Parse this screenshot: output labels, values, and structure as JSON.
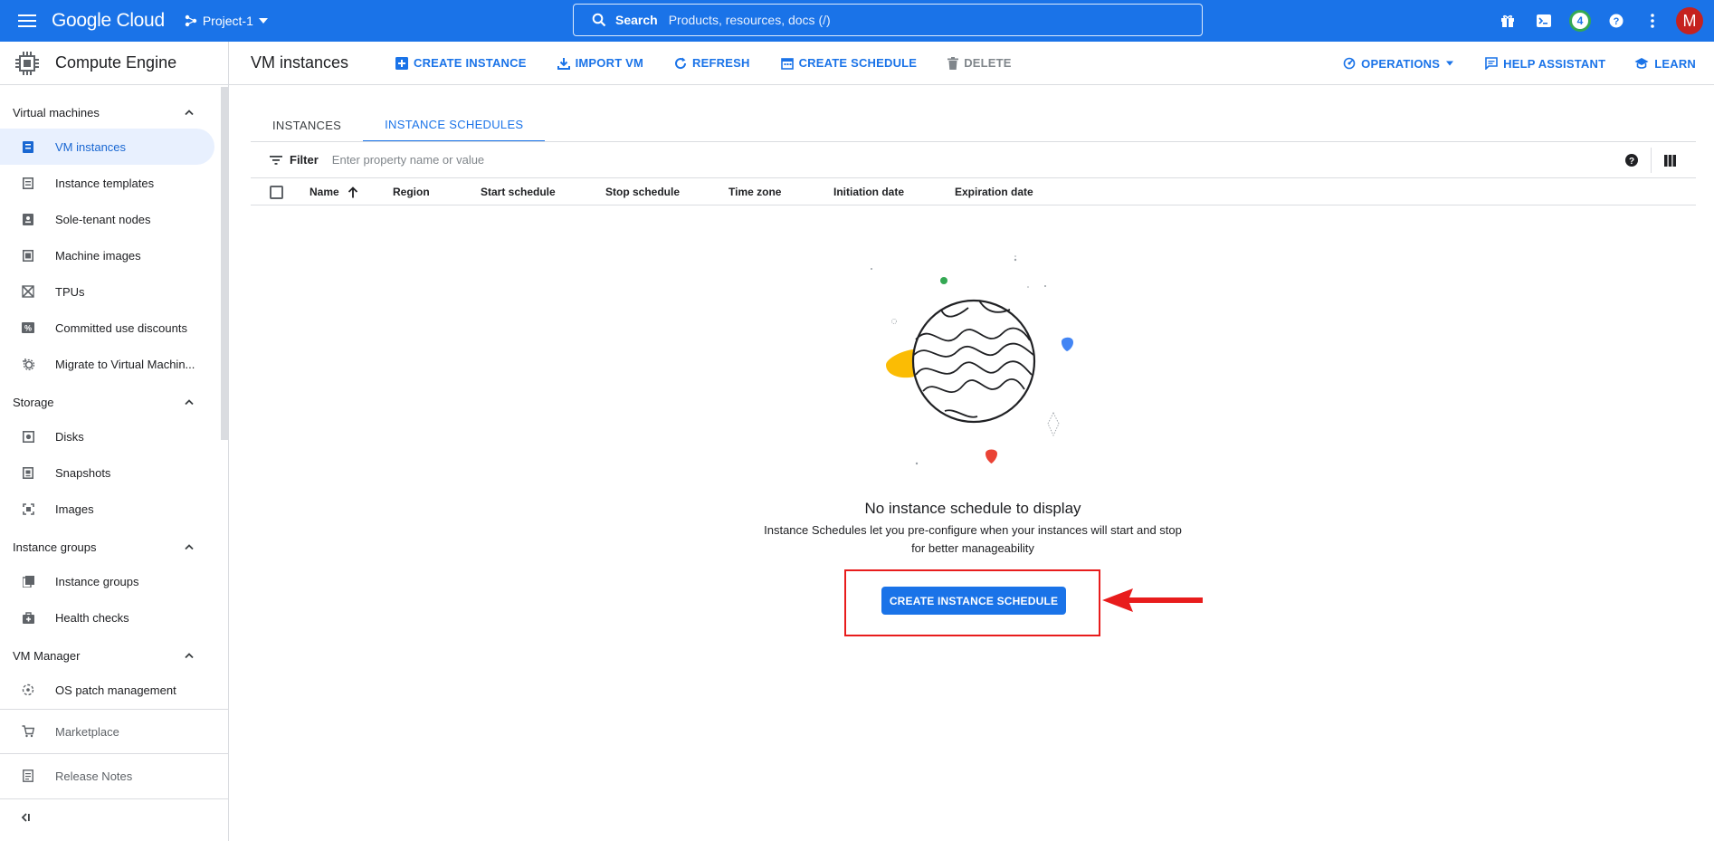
{
  "topbar": {
    "logo": "Google Cloud",
    "project": "Project-1",
    "search_label": "Search",
    "search_placeholder": "Products, resources, docs (/)",
    "notifications_count": "4",
    "avatar_letter": "M"
  },
  "sidebar": {
    "title": "Compute Engine",
    "sections": [
      {
        "label": "Virtual machines",
        "items": [
          "VM instances",
          "Instance templates",
          "Sole-tenant nodes",
          "Machine images",
          "TPUs",
          "Committed use discounts",
          "Migrate to Virtual Machin..."
        ]
      },
      {
        "label": "Storage",
        "items": [
          "Disks",
          "Snapshots",
          "Images"
        ]
      },
      {
        "label": "Instance groups",
        "items": [
          "Instance groups",
          "Health checks"
        ]
      },
      {
        "label": "VM Manager",
        "items": [
          "OS patch management"
        ]
      }
    ],
    "marketplace": "Marketplace",
    "release_notes": "Release Notes"
  },
  "header": {
    "title": "VM instances",
    "create_instance": "CREATE INSTANCE",
    "import_vm": "IMPORT VM",
    "refresh": "REFRESH",
    "create_schedule": "CREATE SCHEDULE",
    "delete": "DELETE",
    "operations": "OPERATIONS",
    "help_assistant": "HELP ASSISTANT",
    "learn": "LEARN"
  },
  "tabs": [
    {
      "label": "INSTANCES",
      "active": false
    },
    {
      "label": "INSTANCE SCHEDULES",
      "active": true
    }
  ],
  "filter": {
    "label": "Filter",
    "placeholder": "Enter property name or value"
  },
  "table": {
    "columns": [
      "Name",
      "Region",
      "Start schedule",
      "Stop schedule",
      "Time zone",
      "Initiation date",
      "Expiration date"
    ],
    "sort_column": "Name",
    "sort_direction": "ascending"
  },
  "empty_state": {
    "title": "No instance schedule to display",
    "description_line1": "Instance Schedules let you pre-configure when your instances will start and stop",
    "description_line2": "for better manageability",
    "button": "CREATE INSTANCE SCHEDULE"
  },
  "colors": {
    "brand_blue": "#1a73e8",
    "annotation_red": "#e81c1c"
  }
}
